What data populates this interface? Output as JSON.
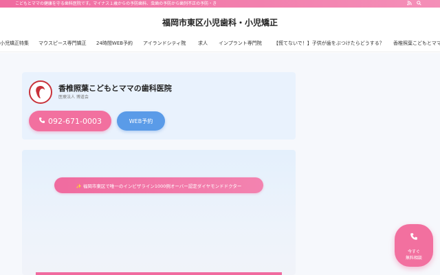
{
  "topbar": {
    "message": "こどもとママの健康を守る歯科医院です。マイナス１歳からの予防歯科、虫歯の予防から歯列不正の予防・き",
    "icons": [
      "rss-icon",
      "search-icon"
    ]
  },
  "site": {
    "title": "福岡市東区小児歯科・小児矯正"
  },
  "nav": {
    "items": [
      "小児矯正特集",
      "マウスピース専門矯正",
      "24時間WEB予約",
      "アイランドシティ院",
      "求人",
      "インプラント専門院",
      "【慌てないで！】子供が歯をぶつけたらどうする？",
      "香椎照葉こどもとママの"
    ]
  },
  "clinic": {
    "name": "香椎照葉こどもとママの歯科医院",
    "corp": "医療法人 博道会",
    "phone_label": "092-671-0003",
    "web_label": "WEB予約"
  },
  "hero": {
    "badge": "✨ 福岡市東区で唯一のインビザライン1000例オーバー認定ダイヤモンドドクター"
  },
  "floating": {
    "line1": "今すぐ",
    "line2": "無料相談"
  },
  "colors": {
    "accent_pink": "#f2709f",
    "accent_blue": "#5a9be8",
    "logo_red": "#c8323a"
  }
}
